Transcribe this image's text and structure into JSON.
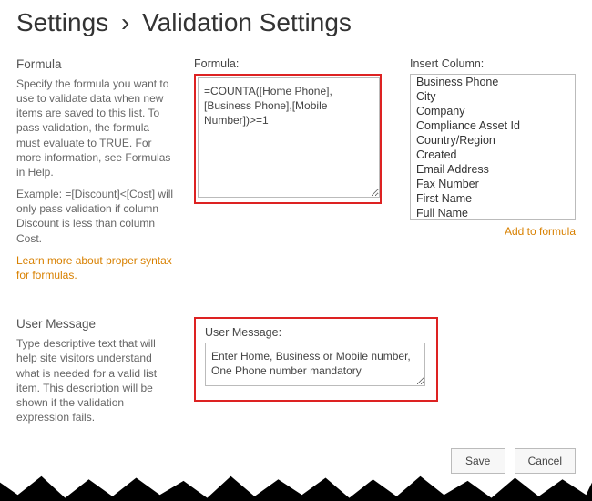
{
  "breadcrumb": {
    "root": "Settings",
    "sep": "›",
    "current": "Validation Settings"
  },
  "formula_section": {
    "heading": "Formula",
    "help1": "Specify the formula you want to use to validate data when new items are saved to this list. To pass validation, the formula must evaluate to TRUE. For more information, see Formulas in Help.",
    "help2": "Example: =[Discount]<[Cost] will only pass validation if column Discount is less than column Cost.",
    "learn_link": "Learn more about proper syntax for formulas.",
    "formula_label": "Formula:",
    "formula_value": "=COUNTA([Home Phone],[Business Phone],[Mobile Number])>=1",
    "insert_label": "Insert Column:",
    "columns": [
      "Business Phone",
      "City",
      "Company",
      "Compliance Asset Id",
      "Country/Region",
      "Created",
      "Email Address",
      "Fax Number",
      "First Name",
      "Full Name"
    ],
    "add_link": "Add to formula"
  },
  "usermsg_section": {
    "heading": "User Message",
    "help": "Type descriptive text that will help site visitors understand what is needed for a valid list item. This description will be shown if the validation expression fails.",
    "label": "User Message:",
    "value": "Enter Home, Business or Mobile number, One Phone number mandatory"
  },
  "buttons": {
    "save": "Save",
    "cancel": "Cancel"
  }
}
